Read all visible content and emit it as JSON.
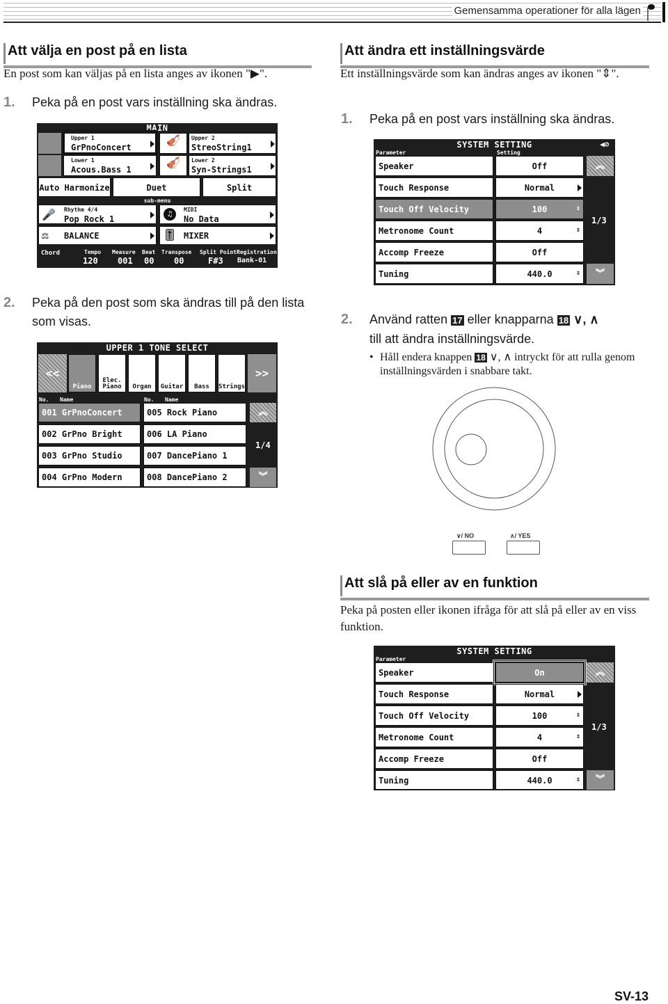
{
  "header": {
    "title": "Gemensamma operationer för alla lägen",
    "icon": "music-note-icon"
  },
  "left_section": {
    "heading": "Att välja en post på en lista",
    "intro": "En post som kan väljas på en lista anges av ikonen \"▶\".",
    "step1": {
      "number": "1",
      "text": "Peka på en post vars inställning ska ändras."
    },
    "main_screen": {
      "title": "MAIN",
      "parts": [
        {
          "label": "Upper 1",
          "value": "GrPnoConcert",
          "icon": "piano-icon",
          "focused": true
        },
        {
          "label": "Upper 2",
          "value": "StreoString1",
          "icon": "violin-icon"
        },
        {
          "label": "Lower 1",
          "value": "Acous.Bass 1",
          "icon": "guitar-icon"
        },
        {
          "label": "Lower 2",
          "value": "Syn-Strings1",
          "icon": "violin-icon"
        }
      ],
      "modes": [
        "Auto Harmonize",
        "Duet",
        "Split"
      ],
      "submenu_label": "sub-menu",
      "submenu": [
        {
          "label": "Rhythm 4/4",
          "value": "Pop Rock 1",
          "icon": "microphone-icon"
        },
        {
          "label": "MIDI",
          "value": "No Data",
          "icon": "music-note-circle-icon"
        },
        {
          "label": "",
          "value": "BALANCE",
          "icon": "balance-icon"
        },
        {
          "label": "",
          "value": "MIXER",
          "icon": "mixer-icon"
        }
      ],
      "status": {
        "chord": "Chord",
        "fields": [
          {
            "label": "Tempo",
            "value": "120"
          },
          {
            "label": "Measure",
            "value": "001"
          },
          {
            "label": "Beat",
            "value": "00"
          },
          {
            "label": "Transpose",
            "value": "00"
          },
          {
            "label": "Split Point",
            "value": "F#3"
          },
          {
            "label": "Registration",
            "value": "Bank-01"
          }
        ]
      }
    },
    "step2": {
      "number": "2",
      "text": "Peka på den post som ska ändras till på den lista som visas."
    },
    "tone_screen": {
      "title": "UPPER 1 TONE SELECT",
      "prev": "<<",
      "next": ">>",
      "categories": [
        "Piano",
        "Elec. Piano",
        "Organ",
        "Guitar",
        "Bass",
        "Strings"
      ],
      "selected_category": "Piano",
      "col_headers": [
        "No.",
        "Name"
      ],
      "tones": [
        "001 GrPnoConcert",
        "002 GrPno Bright",
        "003 GrPno Studio",
        "004 GrPno Modern",
        "005 Rock Piano",
        "006 LA Piano",
        "007 DancePiano 1",
        "008 DancePiano 2"
      ],
      "selected_tone": "001 GrPnoConcert",
      "page": "1/4"
    }
  },
  "right_section": {
    "heading": "Att ändra ett inställningsvärde",
    "intro": "Ett inställningsvärde som kan ändras anges av ikonen \"⇕\".",
    "step1": {
      "number": "1",
      "text": "Peka på en post vars inställning ska ändras."
    },
    "settings_screen_1": {
      "title": "SYSTEM SETTING",
      "col_param": "Parameter",
      "col_setting": "Setting",
      "rows": [
        {
          "param": "Speaker",
          "value": "Off",
          "control": "none"
        },
        {
          "param": "Touch Response",
          "value": "Normal",
          "control": "arrow"
        },
        {
          "param": "Touch Off Velocity",
          "value": "100",
          "control": "updown",
          "selected": true
        },
        {
          "param": "Metronome Count",
          "value": "4",
          "control": "updown"
        },
        {
          "param": "Accomp Freeze",
          "value": "Off",
          "control": "none"
        },
        {
          "param": "Tuning",
          "value": "440.0",
          "control": "updown"
        }
      ],
      "page": "1/3"
    },
    "step2": {
      "number": "2",
      "text_a": "Använd ratten",
      "badge17": "17",
      "text_b": "eller knapparna",
      "badge18": "18",
      "text_c": "∨, ∧",
      "text_d": "till att ändra inställningsvärde.",
      "bullet_a": "Håll endera knappen",
      "bullet_badge": "18",
      "bullet_b": "∨, ∧ intryckt för att rulla genom inställningsvärden i snabbare takt."
    },
    "dial": {
      "no_label": "∨/ NO",
      "yes_label": "∧/ YES"
    },
    "toggle_section": {
      "heading": "Att slå på eller av en funktion",
      "intro": "Peka på posten eller ikonen ifråga för att slå på eller av en viss funktion."
    },
    "settings_screen_2": {
      "title": "SYSTEM SETTING",
      "col_param": "Parameter",
      "rows": [
        {
          "param": "Speaker",
          "value": "On",
          "control": "none",
          "focused": true
        },
        {
          "param": "Touch Response",
          "value": "Normal",
          "control": "arrow"
        },
        {
          "param": "Touch Off Velocity",
          "value": "100",
          "control": "updown"
        },
        {
          "param": "Metronome Count",
          "value": "4",
          "control": "updown"
        },
        {
          "param": "Accomp Freeze",
          "value": "Off",
          "control": "none"
        },
        {
          "param": "Tuning",
          "value": "440.0",
          "control": "updown"
        }
      ],
      "page": "1/3"
    }
  },
  "footer": {
    "page_number": "SV-13"
  }
}
